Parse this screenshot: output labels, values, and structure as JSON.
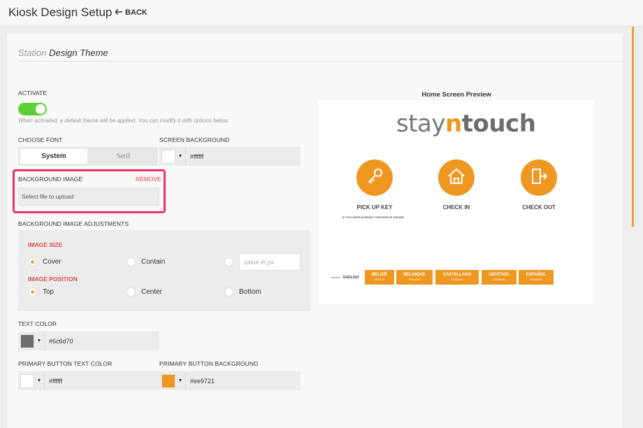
{
  "header": {
    "title": "Kiosk Design Setup",
    "back_label": "BACK"
  },
  "section": {
    "prefix": "Station",
    "title": "Design Theme"
  },
  "activate": {
    "label": "ACTIVATE",
    "on": true,
    "hint": "When activated, a default theme will be applied. You can modify it with options below."
  },
  "font": {
    "label": "CHOOSE FONT",
    "options": [
      "System",
      "Serif"
    ],
    "selected": "System"
  },
  "screen_background": {
    "label": "SCREEN BACKGROUND",
    "value": "#ffffff"
  },
  "background_image": {
    "label": "BACKGROUND IMAGE",
    "remove_label": "REMOVE",
    "placeholder": "Select file to upload"
  },
  "adjustments": {
    "label": "BACKGROUND IMAGE ADJUSTMENTS",
    "size_label": "IMAGE SIZE",
    "size_options": [
      "Cover",
      "Contain"
    ],
    "size_selected": "Cover",
    "px_placeholder": "value in px",
    "position_label": "IMAGE POSITION",
    "position_options": [
      "Top",
      "Center",
      "Bottom"
    ],
    "position_selected": "Top"
  },
  "text_color": {
    "label": "TEXT COLOR",
    "value": "#6c6d70"
  },
  "primary_button_text": {
    "label": "PRIMARY BUTTON TEXT COLOR",
    "value": "#ffffff"
  },
  "primary_button_bg": {
    "label": "PRIMARY BUTTON BACKGROUND",
    "value": "#ee9721"
  },
  "preview": {
    "title": "Home Screen Preview",
    "logo": {
      "part1": "stay",
      "part2": "n",
      "part3": "touch"
    },
    "actions": [
      {
        "label": "PICK UP KEY",
        "icon": "key-icon"
      },
      {
        "label": "CHECK IN",
        "icon": "home-icon"
      },
      {
        "label": "CHECK OUT",
        "icon": "exit-door-icon"
      }
    ],
    "pickup_note": "IF YOU HAVE ALREADY CHECKED IN ONLINE.",
    "current_language": "ENGLISH",
    "languages": [
      {
        "name": "BELGIË",
        "sub": "DUTCH"
      },
      {
        "name": "BELGIQUE",
        "sub": "FRENCH"
      },
      {
        "name": "CASTELLANO",
        "sub": "SPANISH"
      },
      {
        "name": "DEUTSCH",
        "sub": "GERMAN"
      },
      {
        "name": "ESPAÑOL",
        "sub": "SPANISH"
      }
    ]
  },
  "colors": {
    "accent": "#ee9721",
    "toggle_on": "#5ecf33",
    "highlight_border": "#f0306a",
    "remove_red": "#e3454c"
  }
}
